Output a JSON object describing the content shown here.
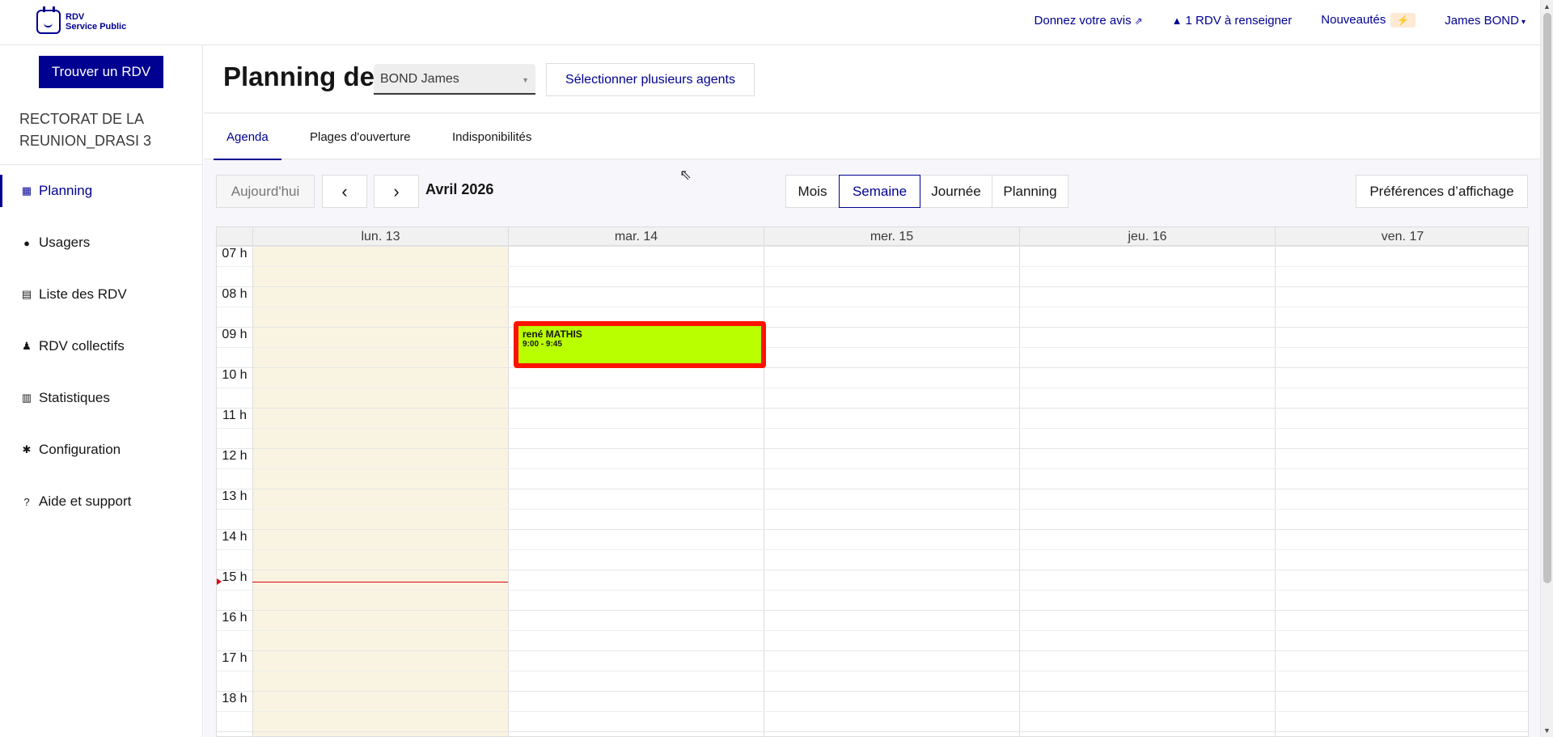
{
  "header": {
    "logo_line1": "RDV",
    "logo_line2": "Service Public",
    "feedback_link": "Donnez votre avis",
    "rdv_alert": "1 RDV à renseigner",
    "news_label": "Nouveautés",
    "news_badge": "⚡",
    "user_menu": "James BOND"
  },
  "sidebar": {
    "cta_label": "Trouver un RDV",
    "org_name": "RECTORAT DE LA REUNION_DRASI 3",
    "items": [
      {
        "label": "Planning",
        "icon": "calendar-icon",
        "active": true
      },
      {
        "label": "Usagers",
        "icon": "users-icon"
      },
      {
        "label": "Liste des RDV",
        "icon": "list-icon"
      },
      {
        "label": "RDV collectifs",
        "icon": "group-icon"
      },
      {
        "label": "Statistiques",
        "icon": "chart-icon"
      },
      {
        "label": "Configuration",
        "icon": "gear-icon"
      },
      {
        "label": "Aide et support",
        "icon": "help-icon"
      }
    ]
  },
  "page": {
    "title": "Planning de",
    "agent_value": "BOND James",
    "multi_agent_button": "Sélectionner plusieurs agents"
  },
  "tabs": [
    {
      "label": "Agenda",
      "active": true
    },
    {
      "label": "Plages d'ouverture"
    },
    {
      "label": "Indisponibilités"
    }
  ],
  "toolbar": {
    "today": "Aujourd'hui",
    "prev_icon": "chevron-left-icon",
    "next_icon": "chevron-right-icon",
    "period": "Avril 2026",
    "views": [
      "Mois",
      "Semaine",
      "Journée",
      "Planning"
    ],
    "active_view": "Semaine",
    "preferences": "Préférences d’affichage"
  },
  "calendar": {
    "days": [
      "lun. 13",
      "mar. 14",
      "mer. 15",
      "jeu. 16",
      "ven. 17"
    ],
    "today_index": 0,
    "hours": [
      "07 h",
      "08 h",
      "09 h",
      "10 h",
      "11 h",
      "12 h",
      "13 h",
      "14 h",
      "15 h",
      "16 h",
      "17 h",
      "18 h"
    ],
    "events": [
      {
        "name": "rené MATHIS",
        "time": "9:00 - 9:45",
        "day_index": 1,
        "color": "#b9ff00",
        "border_color": "#ff1200"
      }
    ]
  },
  "colors": {
    "primary": "#000091",
    "today_bg": "#f8f4e1",
    "now_line": "#e1000f"
  }
}
